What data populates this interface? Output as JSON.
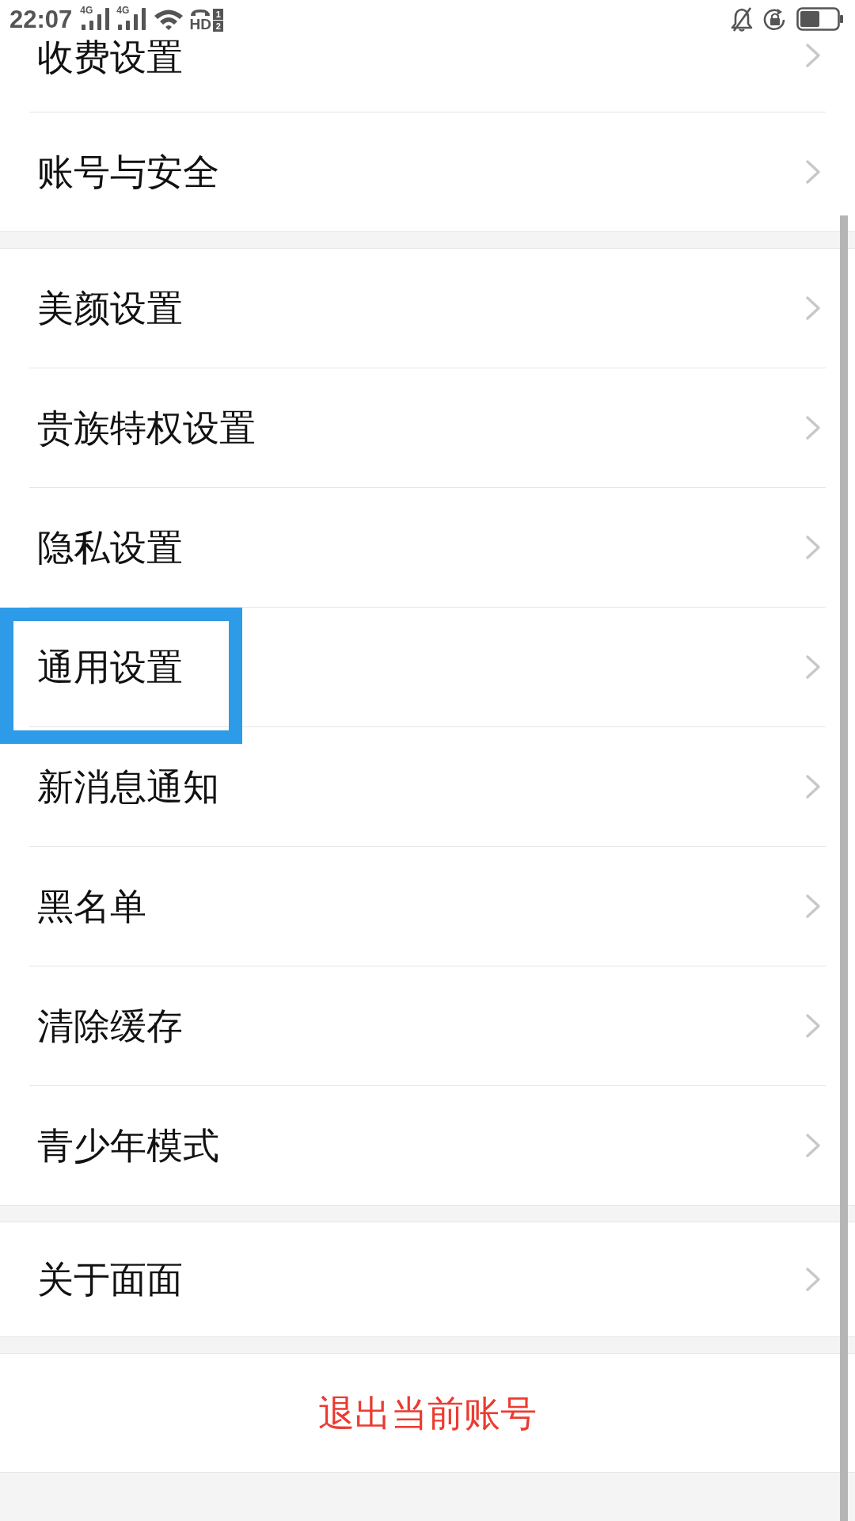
{
  "status_bar": {
    "time": "22:07",
    "network_types": [
      "4G",
      "4G"
    ],
    "hd_label": "HD",
    "sim_slots": [
      "1",
      "2"
    ]
  },
  "sections": [
    {
      "kind": "list",
      "items": [
        {
          "label": "收费设置",
          "highlighted": false
        },
        {
          "label": "账号与安全",
          "highlighted": false
        }
      ]
    },
    {
      "kind": "list",
      "items": [
        {
          "label": "美颜设置",
          "highlighted": false
        },
        {
          "label": "贵族特权设置",
          "highlighted": false
        },
        {
          "label": "隐私设置",
          "highlighted": false
        },
        {
          "label": "通用设置",
          "highlighted": true
        },
        {
          "label": "新消息通知",
          "highlighted": false
        },
        {
          "label": "黑名单",
          "highlighted": false
        },
        {
          "label": "清除缓存",
          "highlighted": false
        },
        {
          "label": "青少年模式",
          "highlighted": false
        }
      ]
    },
    {
      "kind": "list",
      "items": [
        {
          "label": "关于面面",
          "highlighted": false
        }
      ]
    },
    {
      "kind": "action",
      "items": [
        {
          "label": "退出当前账号"
        }
      ]
    }
  ]
}
